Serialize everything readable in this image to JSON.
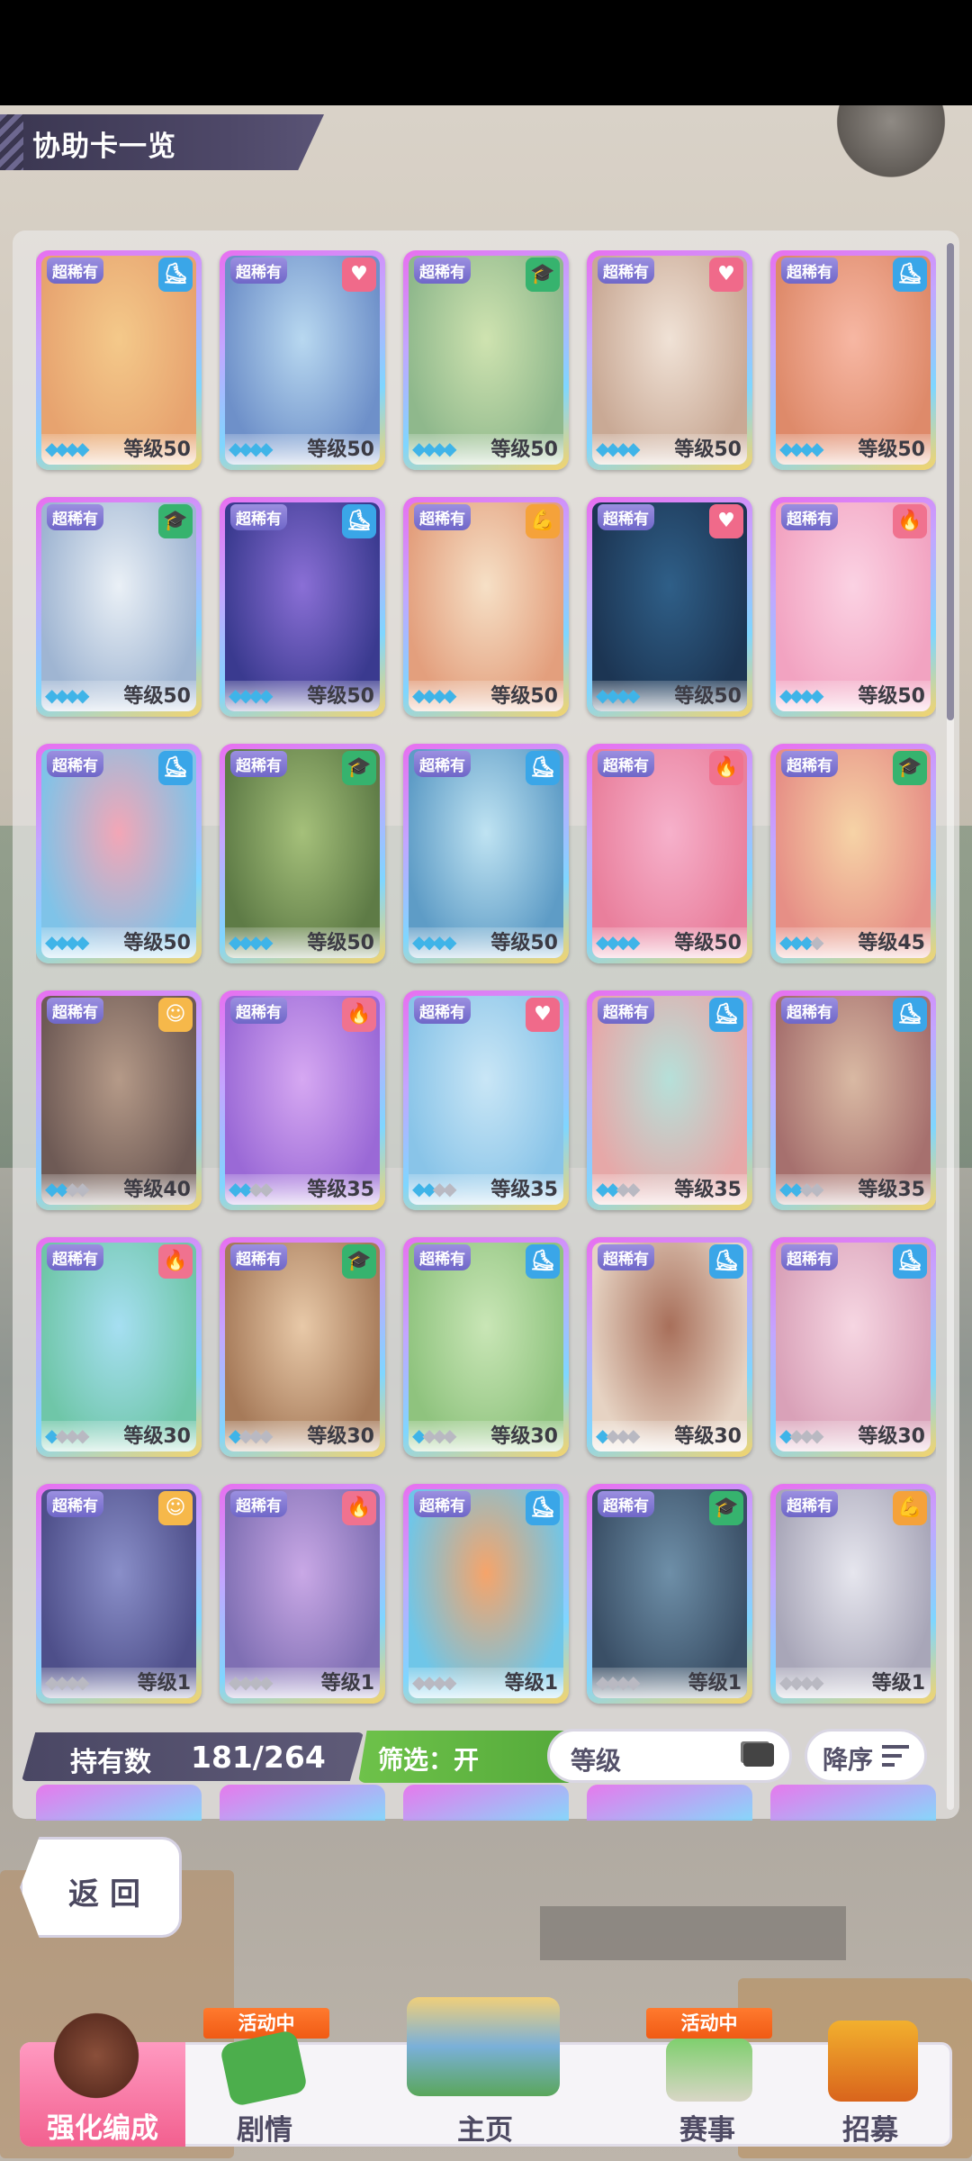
{
  "header": {
    "title": "协助卡一览"
  },
  "cards": [
    {
      "rarity": "超稀有",
      "type": "speed",
      "level": "等级50",
      "gems": 4,
      "colors": [
        "#f4c98a",
        "#e7a36f"
      ]
    },
    {
      "rarity": "超稀有",
      "type": "friend",
      "level": "等级50",
      "gems": 4,
      "colors": [
        "#b8d8f0",
        "#6e90c9"
      ]
    },
    {
      "rarity": "超稀有",
      "type": "wisdom",
      "level": "等级50",
      "gems": 4,
      "colors": [
        "#cfe3b0",
        "#8fb88c"
      ]
    },
    {
      "rarity": "超稀有",
      "type": "friend",
      "level": "等级50",
      "gems": 4,
      "colors": [
        "#f0e2d6",
        "#c9a995"
      ]
    },
    {
      "rarity": "超稀有",
      "type": "speed",
      "level": "等级50",
      "gems": 4,
      "colors": [
        "#f7b7a3",
        "#de8a6a"
      ]
    },
    {
      "rarity": "超稀有",
      "type": "wisdom",
      "level": "等级50",
      "gems": 4,
      "colors": [
        "#eaf0f6",
        "#9fb5d2"
      ]
    },
    {
      "rarity": "超稀有",
      "type": "speed",
      "level": "等级50",
      "gems": 4,
      "colors": [
        "#8a6fd6",
        "#3a3a8f"
      ]
    },
    {
      "rarity": "超稀有",
      "type": "power",
      "level": "等级50",
      "gems": 4,
      "colors": [
        "#f6e0c6",
        "#e39f7d"
      ]
    },
    {
      "rarity": "超稀有",
      "type": "friend",
      "level": "等级50",
      "gems": 4,
      "colors": [
        "#2f5f88",
        "#1c3553"
      ]
    },
    {
      "rarity": "超稀有",
      "type": "guts",
      "level": "等级50",
      "gems": 4,
      "colors": [
        "#fbd2e3",
        "#f2a3c1"
      ]
    },
    {
      "rarity": "超稀有",
      "type": "speed",
      "level": "等级50",
      "gems": 4,
      "colors": [
        "#f3a6b6",
        "#7fc3e8"
      ]
    },
    {
      "rarity": "超稀有",
      "type": "wisdom",
      "level": "等级50",
      "gems": 4,
      "colors": [
        "#a5c07a",
        "#5e7b46"
      ]
    },
    {
      "rarity": "超稀有",
      "type": "speed",
      "level": "等级50",
      "gems": 4,
      "colors": [
        "#bfe3f2",
        "#5e9cc6"
      ]
    },
    {
      "rarity": "超稀有",
      "type": "guts",
      "level": "等级50",
      "gems": 4,
      "colors": [
        "#f6b1cb",
        "#e97f9c"
      ]
    },
    {
      "rarity": "超稀有",
      "type": "wisdom",
      "level": "等级45",
      "gems": 3,
      "colors": [
        "#f6d3a6",
        "#e68f86"
      ]
    },
    {
      "rarity": "超稀有",
      "type": "group",
      "level": "等级40",
      "gems": 2,
      "colors": [
        "#b59a88",
        "#6e5a55"
      ]
    },
    {
      "rarity": "超稀有",
      "type": "guts",
      "level": "等级35",
      "gems": 2,
      "colors": [
        "#d6a8f2",
        "#9a69d6"
      ]
    },
    {
      "rarity": "超稀有",
      "type": "friend",
      "level": "等级35",
      "gems": 2,
      "colors": [
        "#c9e6f6",
        "#89c4e8"
      ]
    },
    {
      "rarity": "超稀有",
      "type": "speed",
      "level": "等级35",
      "gems": 2,
      "colors": [
        "#b6e0d9",
        "#e6a8a8"
      ]
    },
    {
      "rarity": "超稀有",
      "type": "speed",
      "level": "等级35",
      "gems": 2,
      "colors": [
        "#d9b9a3",
        "#a6706e"
      ]
    },
    {
      "rarity": "超稀有",
      "type": "guts",
      "level": "等级30",
      "gems": 1,
      "colors": [
        "#a6dff2",
        "#6fc6a8"
      ]
    },
    {
      "rarity": "超稀有",
      "type": "wisdom",
      "level": "等级30",
      "gems": 1,
      "colors": [
        "#e8c9a8",
        "#a67a59"
      ]
    },
    {
      "rarity": "超稀有",
      "type": "speed",
      "level": "等级30",
      "gems": 1,
      "colors": [
        "#c9e6b6",
        "#8fc37e"
      ]
    },
    {
      "rarity": "超稀有",
      "type": "speed",
      "level": "等级30",
      "gems": 1,
      "colors": [
        "#a86f5a",
        "#e6d3c3"
      ]
    },
    {
      "rarity": "超稀有",
      "type": "speed",
      "level": "等级30",
      "gems": 1,
      "colors": [
        "#f6d6e2",
        "#d9a1b8"
      ]
    },
    {
      "rarity": "超稀有",
      "type": "group",
      "level": "等级1",
      "gems": 0,
      "colors": [
        "#8a8fc9",
        "#4e4f8a"
      ]
    },
    {
      "rarity": "超稀有",
      "type": "guts",
      "level": "等级1",
      "gems": 0,
      "colors": [
        "#c9a8e6",
        "#7f6fb3"
      ]
    },
    {
      "rarity": "超稀有",
      "type": "speed",
      "level": "等级1",
      "gems": 0,
      "colors": [
        "#f6a46a",
        "#6fc6e8"
      ]
    },
    {
      "rarity": "超稀有",
      "type": "wisdom",
      "level": "等级1",
      "gems": 0,
      "colors": [
        "#6e8fa8",
        "#3a4f66"
      ]
    },
    {
      "rarity": "超稀有",
      "type": "power",
      "level": "等级1",
      "gems": 0,
      "colors": [
        "#e6e6ee",
        "#a8a6b8"
      ]
    }
  ],
  "type_colors": {
    "speed": "#3aa6e8",
    "friend": "#f06a8a",
    "wisdom": "#36b36e",
    "power": "#f5a23a",
    "guts": "#f0728f",
    "group": "#f6b84a"
  },
  "type_glyphs": {
    "speed": "⛸",
    "friend": "♥",
    "wisdom": "🎓",
    "power": "💪",
    "guts": "🔥",
    "group": "☺"
  },
  "toolbar": {
    "count_label": "持有数",
    "count_value": "181/264",
    "filter_label": "筛选：开",
    "sort_label": "等级",
    "order_label": "降序"
  },
  "back_label": "返回",
  "nav": {
    "items": [
      {
        "label": "强化编成",
        "active": true,
        "badge": ""
      },
      {
        "label": "剧情",
        "active": false,
        "badge": "活动中"
      },
      {
        "label": "主页",
        "active": false,
        "badge": ""
      },
      {
        "label": "赛事",
        "active": false,
        "badge": "活动中"
      },
      {
        "label": "招募",
        "active": false,
        "badge": ""
      }
    ]
  }
}
